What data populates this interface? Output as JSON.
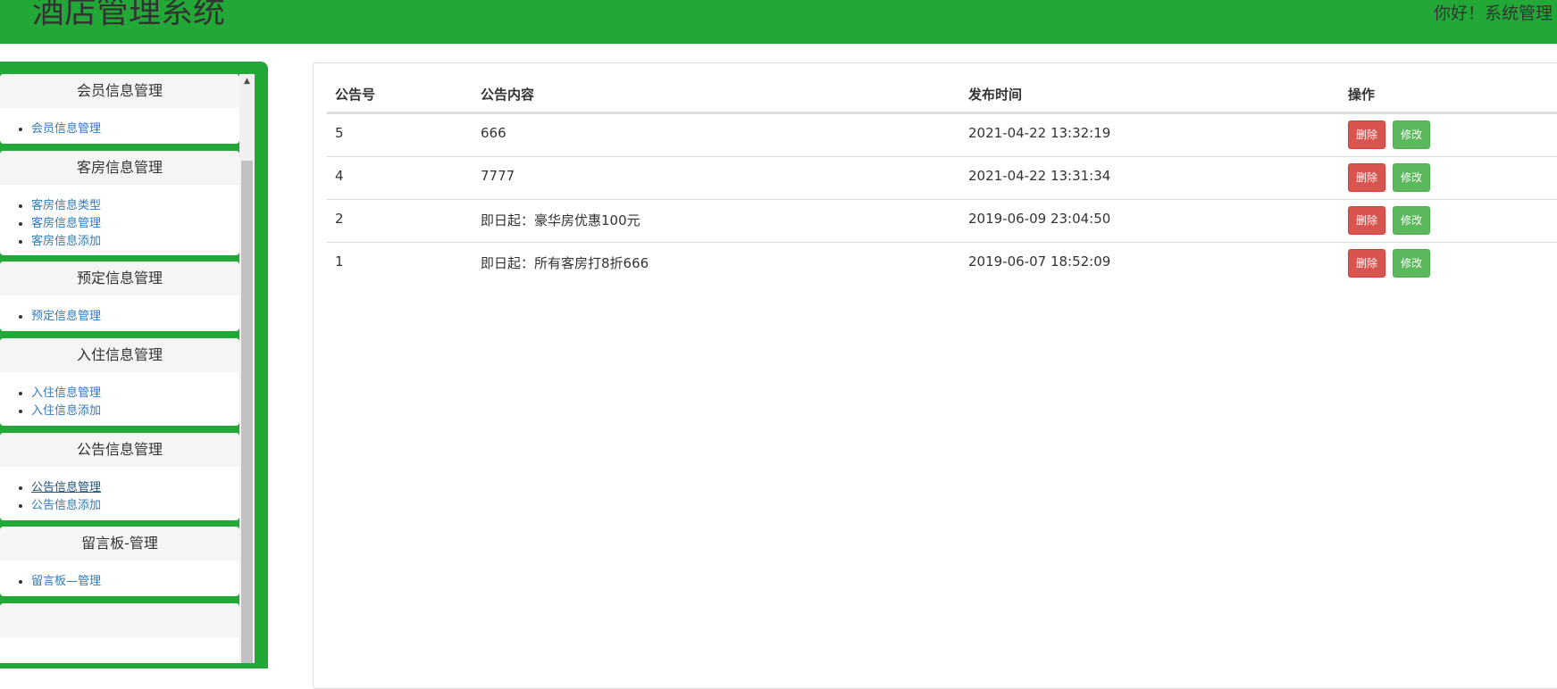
{
  "header": {
    "title": "酒店管理系统",
    "greeting": "你好！系统管理"
  },
  "sidebar": {
    "panels": [
      {
        "title": "会员信息管理",
        "items": [
          "会员信息管理"
        ]
      },
      {
        "title": "客房信息管理",
        "items": [
          "客房信息类型",
          "客房信息管理",
          "客房信息添加"
        ]
      },
      {
        "title": "预定信息管理",
        "items": [
          "预定信息管理"
        ]
      },
      {
        "title": "入住信息管理",
        "items": [
          "入住信息管理",
          "入住信息添加"
        ]
      },
      {
        "title": "公告信息管理",
        "items": [
          "公告信息管理",
          "公告信息添加"
        ]
      },
      {
        "title": "留言板-管理",
        "items": [
          "留言板—管理"
        ]
      }
    ]
  },
  "table": {
    "headers": [
      "公告号",
      "公告内容",
      "发布时间",
      "操作"
    ],
    "rows": [
      {
        "id": "5",
        "content": "666",
        "time": "2021-04-22 13:32:19"
      },
      {
        "id": "4",
        "content": "7777",
        "time": "2021-04-22 13:31:34"
      },
      {
        "id": "2",
        "content": "即日起：豪华房优惠100元",
        "time": "2019-06-09 23:04:50"
      },
      {
        "id": "1",
        "content": "即日起：所有客房打8折666",
        "time": "2019-06-07 18:52:09"
      }
    ],
    "delete_label": "删除",
    "edit_label": "修改"
  },
  "colors": {
    "brand_green": "#22a836",
    "danger": "#d9534f",
    "success": "#5cb85c",
    "link": "#337ab7"
  }
}
